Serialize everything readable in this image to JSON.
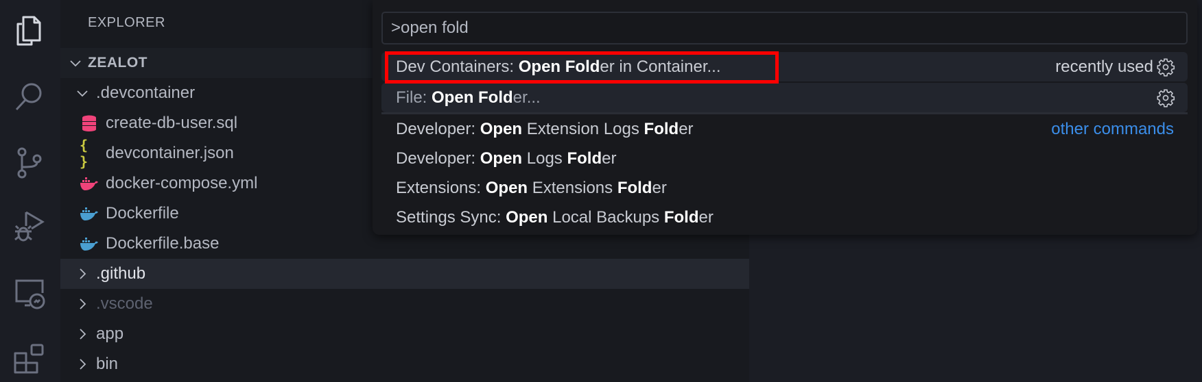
{
  "activity_bar": {
    "items": [
      {
        "icon": "files-icon",
        "active": true
      },
      {
        "icon": "search-icon",
        "active": false
      },
      {
        "icon": "source-control-icon",
        "active": false
      },
      {
        "icon": "run-debug-icon",
        "active": false
      },
      {
        "icon": "remote-explorer-icon",
        "active": false
      },
      {
        "icon": "extensions-icon",
        "active": false
      }
    ]
  },
  "sidebar": {
    "title": "EXPLORER",
    "workspace": "ZEALOT",
    "tree": [
      {
        "name": ".devcontainer",
        "type": "folder",
        "expanded": true,
        "depth": 1
      },
      {
        "name": "create-db-user.sql",
        "type": "file",
        "icon": "database-icon",
        "icon_color": "#f0437a",
        "depth": 2
      },
      {
        "name": "devcontainer.json",
        "type": "file",
        "icon": "json-braces-icon",
        "icon_color": "#cbcb41",
        "depth": 2
      },
      {
        "name": "docker-compose.yml",
        "type": "file",
        "icon": "docker-icon",
        "icon_color": "#f0437a",
        "depth": 2
      },
      {
        "name": "Dockerfile",
        "type": "file",
        "icon": "docker-icon",
        "icon_color": "#4a9fd1",
        "depth": 2
      },
      {
        "name": "Dockerfile.base",
        "type": "file",
        "icon": "docker-icon",
        "icon_color": "#4a9fd1",
        "depth": 2
      },
      {
        "name": ".github",
        "type": "folder",
        "expanded": false,
        "depth": 1,
        "selected": true
      },
      {
        "name": ".vscode",
        "type": "folder",
        "expanded": false,
        "depth": 1,
        "dim": true
      },
      {
        "name": "app",
        "type": "folder",
        "expanded": false,
        "depth": 1
      },
      {
        "name": "bin",
        "type": "folder",
        "expanded": false,
        "depth": 1
      }
    ]
  },
  "palette": {
    "input_value": ">open fold",
    "items": [
      {
        "prefix": "Dev Containers: ",
        "parts": [
          {
            "t": "Open Fold",
            "b": true
          },
          {
            "t": "er in Container...",
            "b": false
          }
        ],
        "right": "recently used",
        "gear": true,
        "highlighted": true
      },
      {
        "prefix": "File: ",
        "parts": [
          {
            "t": "Open Fold",
            "b": true
          },
          {
            "t": "er...",
            "b": false,
            "muted": true
          }
        ],
        "gear": true,
        "highlighted": true
      },
      {
        "prefix": "Developer: ",
        "parts": [
          {
            "t": "Open",
            "b": true
          },
          {
            "t": " Extension Logs ",
            "b": false
          },
          {
            "t": "Fold",
            "b": true
          },
          {
            "t": "er",
            "b": false
          }
        ],
        "link": "other commands"
      },
      {
        "prefix": "Developer: ",
        "parts": [
          {
            "t": "Open",
            "b": true
          },
          {
            "t": " Logs ",
            "b": false
          },
          {
            "t": "Fold",
            "b": true
          },
          {
            "t": "er",
            "b": false
          }
        ]
      },
      {
        "prefix": "Extensions: ",
        "parts": [
          {
            "t": "Open",
            "b": true
          },
          {
            "t": " Extensions ",
            "b": false
          },
          {
            "t": "Fold",
            "b": true
          },
          {
            "t": "er",
            "b": false
          }
        ]
      },
      {
        "prefix": "Settings Sync: ",
        "parts": [
          {
            "t": "Open",
            "b": true
          },
          {
            "t": " Local Backups ",
            "b": false
          },
          {
            "t": "Fold",
            "b": true
          },
          {
            "t": "er",
            "b": false
          }
        ]
      }
    ]
  },
  "annotation": {
    "highlight_color": "#ff0000",
    "target": "Dev Containers: Open Folder in Container..."
  }
}
